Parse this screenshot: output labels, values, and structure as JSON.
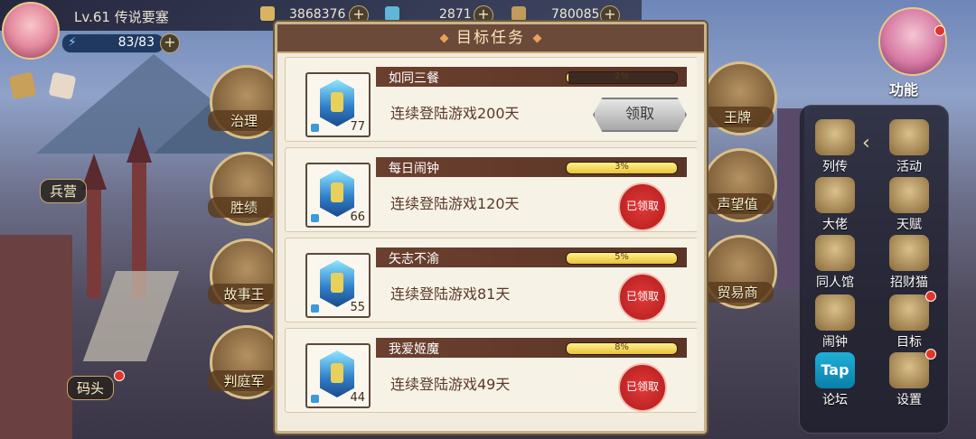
{
  "player": {
    "level_title": "Lv.61  传说要塞",
    "energy": "83/83"
  },
  "resources": [
    {
      "value": "3868376",
      "icon": "gold-icon",
      "color": "#d8b460"
    },
    {
      "value": "2871",
      "icon": "gem-icon",
      "color": "#5fb6d6"
    },
    {
      "value": "780085",
      "icon": "food-icon",
      "color": "#c29a5a"
    }
  ],
  "buildings": [
    {
      "label": "治理"
    },
    {
      "label": "胜绩"
    },
    {
      "label": "故事王"
    },
    {
      "label": "判庭军"
    },
    {
      "label": "王牌"
    },
    {
      "label": "声望值"
    },
    {
      "label": "贸易商"
    }
  ],
  "side_buttons": {
    "barracks": "兵营",
    "dock": "码头"
  },
  "function_label": "功能",
  "right_menu": [
    {
      "label": "列传",
      "icon": "book-icon"
    },
    {
      "label": "活动",
      "icon": "star-badge-icon"
    },
    {
      "label": "大佬",
      "icon": "crown-icon"
    },
    {
      "label": "天赋",
      "icon": "talent-icon"
    },
    {
      "label": "同人馆",
      "icon": "hall-icon"
    },
    {
      "label": "招财猫",
      "icon": "lucky-cat-icon"
    },
    {
      "label": "闹钟",
      "icon": "clock-icon"
    },
    {
      "label": "目标",
      "icon": "target-icon"
    },
    {
      "label": "论坛",
      "icon": "tap-forum-icon"
    },
    {
      "label": "设置",
      "icon": "gear-icon"
    }
  ],
  "modal": {
    "title": "目标任务",
    "claim_label": "领取",
    "claimed_label": "已领取",
    "tasks": [
      {
        "name": "如同三餐",
        "desc": "连续登陆游戏200天",
        "progress_text": "2%",
        "progress": 0.02,
        "count": "77",
        "status": "claimable"
      },
      {
        "name": "每日闹钟",
        "desc": "连续登陆游戏120天",
        "progress_text": "3%",
        "progress": 1.0,
        "count": "66",
        "status": "claimed"
      },
      {
        "name": "矢志不渝",
        "desc": "连续登陆游戏81天",
        "progress_text": "5%",
        "progress": 1.0,
        "count": "55",
        "status": "claimed"
      },
      {
        "name": "我爱姬魔",
        "desc": "连续登陆游戏49天",
        "progress_text": "8%",
        "progress": 1.0,
        "count": "44",
        "status": "claimed"
      }
    ]
  }
}
